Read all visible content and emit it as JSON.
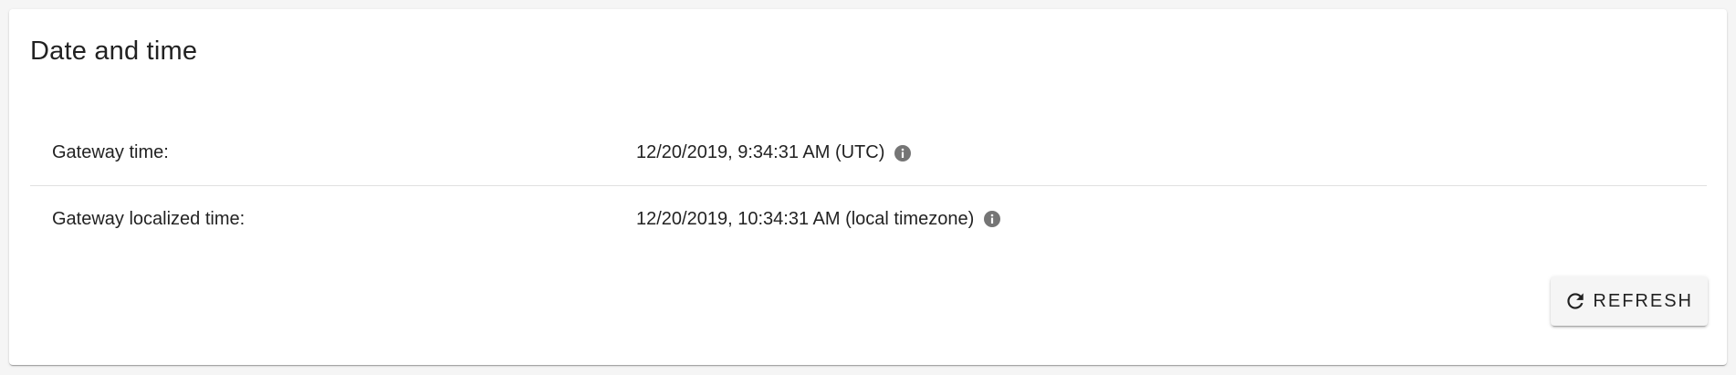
{
  "card": {
    "title": "Date and time"
  },
  "rows": [
    {
      "label": "Gateway time:",
      "value": "12/20/2019, 9:34:31 AM (UTC)",
      "icon": "info-icon"
    },
    {
      "label": "Gateway localized time:",
      "value": "12/20/2019, 10:34:31 AM (local timezone)",
      "icon": "info-icon"
    }
  ],
  "actions": {
    "refresh_label": "REFRESH",
    "refresh_icon": "refresh-icon"
  },
  "colors": {
    "text": "#212121",
    "icon": "#757575",
    "divider": "#e0e0e0",
    "button_bg": "#f5f5f5",
    "card_bg": "#ffffff",
    "page_bg": "#f5f5f5"
  }
}
